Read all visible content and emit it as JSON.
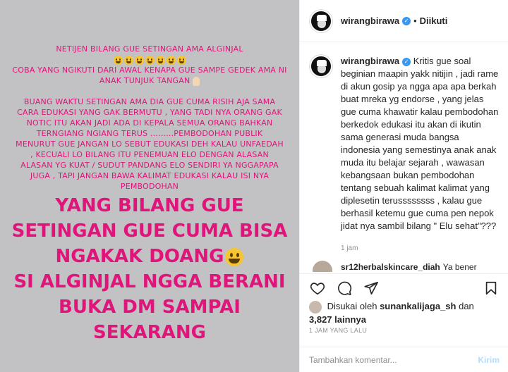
{
  "story": {
    "lines_small": [
      "NETIJEN BILANG GUE SETINGAN AMA ALGINJAL",
      "COBA YANG NGIKUTI DARI AWAL KENAPA GUE SAMPE GEDEK AMA NI ANAK TUNJUK TANGAN",
      "BUANG WAKTU SETINGAN AMA DIA GUE CUMA RISIH AJA SAMA CARA EDUKASI YANG GAK BERMUTU , YANG TADI NYA ORANG GAK NOTIC ITU AKAN JADI ADA DI KEPALA SEMUA ORANG BAHKAN TERNGIANG NGIANG TERUS .........PEMBODOHAN PUBLIK MENURUT GUE JANGAN LO SEBUT EDUKASI DEH KALAU UNFAEDAH , KECUALI LO BILANG ITU PENEMUAN ELO DENGAN ALASAN ALASAN YG KUAT / SUDUT PANDANG ELO SENDIRI YA NGGAPAPA JUGA , TAPI JANGAN BAWA KALIMAT EDUKASI KALAU ISI NYA PEMBODOHAN"
    ],
    "lines_big": [
      "YANG BILANG GUE",
      "SETINGAN GUE CUMA BISA",
      "NGAKAK DOANG",
      "SI ALGINJAL NGGA BERANI",
      "BUKA DM SAMPAI",
      "SEKARANG"
    ]
  },
  "header": {
    "username": "wirangbirawa",
    "separator": "•",
    "follow_status": "Diikuti"
  },
  "caption": {
    "username": "wirangbirawa",
    "text": "Kritis gue soal beginian maapin yakk nitijin , jadi rame di akun gosip ya ngga apa apa berkah buat mreka yg endorse , yang jelas gue cuma khawatir kalau pembodohan berkedok edukasi itu akan di ikutin sama generasi muda bangsa indonesia yang semestinya anak anak muda itu belajar sejarah , wawasan kebangsaan bukan pembodohan tentang sebuah kalimat kalimat yang diplesetin terussssssss , kalau gue berhasil ketemu gue cuma pen nepok jidat nya sambil bilang \" Elu sehat\"???",
    "time": "1 jam"
  },
  "next_comment": {
    "username": "sr12herbalskincare_diah",
    "text": "Ya bener"
  },
  "likes": {
    "prefix": "Disukai oleh",
    "user": "sunankalijaga_sh",
    "joiner": "dan",
    "count": "3,827 lainnya"
  },
  "posted_ago": "1 JAM YANG LALU",
  "comment_box": {
    "placeholder": "Tambahkan komentar...",
    "send_label": "Kirim"
  },
  "colors": {
    "story_bg": "#c2c2c4",
    "story_text": "#e0147a",
    "verified": "#3897f0",
    "send_disabled": "#b2dffc"
  }
}
